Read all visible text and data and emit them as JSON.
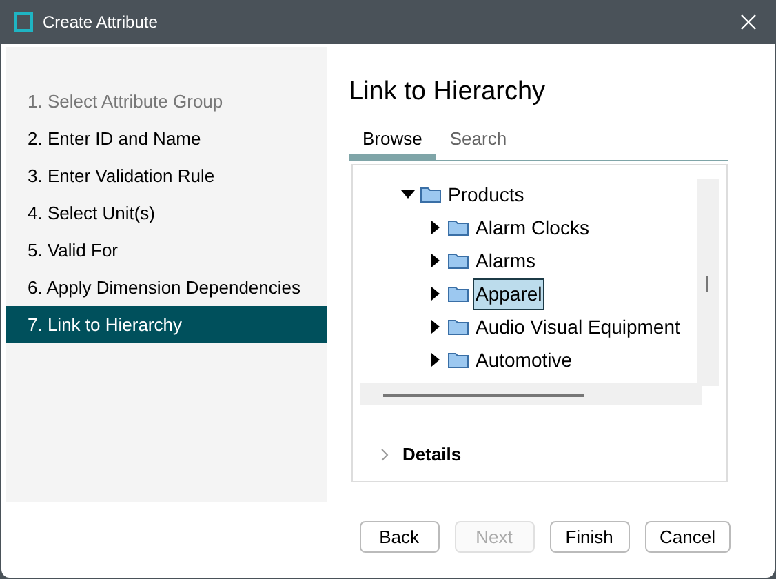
{
  "window": {
    "title": "Create Attribute"
  },
  "steps": [
    {
      "label": "1. Select Attribute Group",
      "selected": false,
      "disabled": true
    },
    {
      "label": "2. Enter ID and Name",
      "selected": false,
      "disabled": false
    },
    {
      "label": "3. Enter Validation Rule",
      "selected": false,
      "disabled": false
    },
    {
      "label": "4. Select Unit(s)",
      "selected": false,
      "disabled": false
    },
    {
      "label": "5. Valid For",
      "selected": false,
      "disabled": false
    },
    {
      "label": "6. Apply Dimension Dependencies",
      "selected": false,
      "disabled": false
    },
    {
      "label": "7. Link to Hierarchy",
      "selected": true,
      "disabled": false
    }
  ],
  "heading": "Link to Hierarchy",
  "tabs": [
    {
      "label": "Browse",
      "selected": true
    },
    {
      "label": "Search",
      "selected": false
    }
  ],
  "tree": [
    {
      "label": "Products",
      "expanded": true,
      "selected": false,
      "children": [
        {
          "label": "Alarm Clocks",
          "expanded": false,
          "selected": false
        },
        {
          "label": "Alarms",
          "expanded": false,
          "selected": false
        },
        {
          "label": "Apparel",
          "expanded": false,
          "selected": true
        },
        {
          "label": "Audio Visual Equipment",
          "expanded": false,
          "selected": false
        },
        {
          "label": "Automotive",
          "expanded": false,
          "selected": false
        }
      ]
    }
  ],
  "details": {
    "label": "Details",
    "expanded": false
  },
  "buttons": [
    {
      "label": "Back",
      "disabled": false
    },
    {
      "label": "Next",
      "disabled": true
    },
    {
      "label": "Finish",
      "disabled": false
    },
    {
      "label": "Cancel",
      "disabled": false
    }
  ]
}
